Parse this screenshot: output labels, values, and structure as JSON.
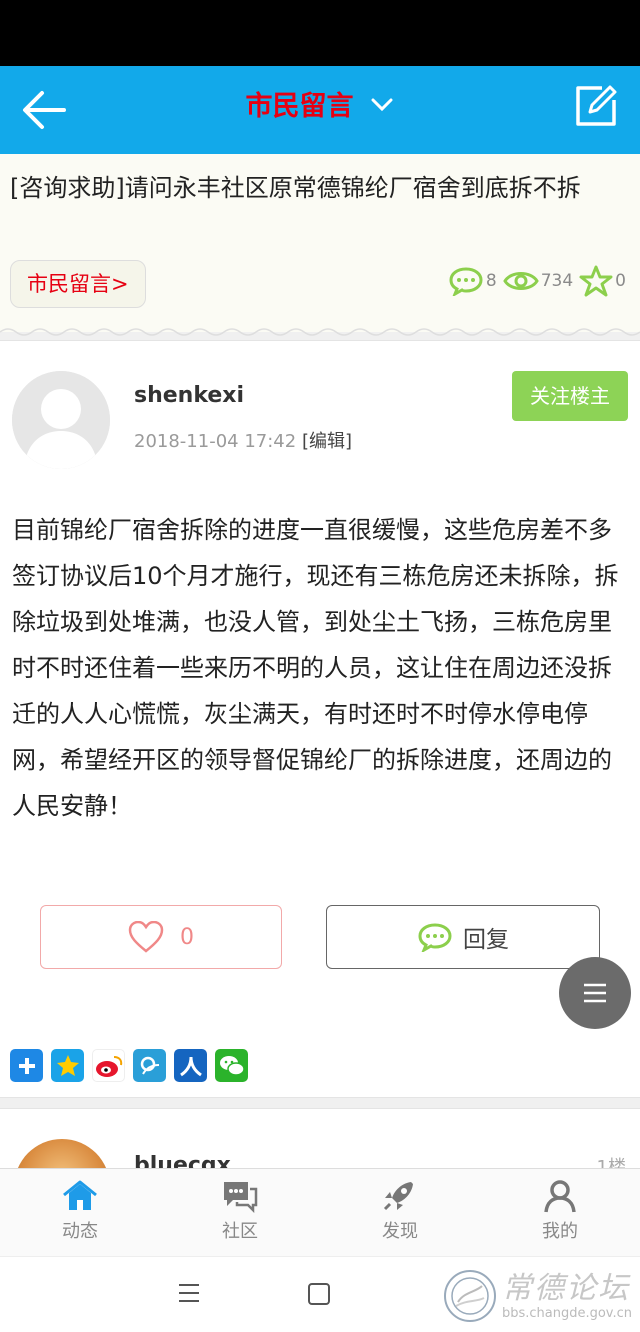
{
  "topbar": {
    "title": "市民留言"
  },
  "post": {
    "title": "[咨询求助]请问永丰社区原常德锦纶厂宿舍到底拆不拆",
    "forum_tag": "市民留言>",
    "stats": {
      "replies": "8",
      "views": "734",
      "favorites": "0"
    },
    "author": "shenkexi",
    "datetime": "2018-11-04 17:42",
    "edit_label": "[编辑]",
    "follow_label": "关注楼主",
    "content": "目前锦纶厂宿舍拆除的进度一直很缓慢，这些危房差不多签订协议后10个月才施行，现还有三栋危房还未拆除，拆除垃圾到处堆满，也没人管，到处尘土飞扬，三栋危房里时不时还住着一些来历不明的人员，这让住在周边还没拆迁的人人心慌慌，灰尘满天，有时还时不时停水停电停网，希望经开区的领导督促锦纶厂的拆除进度，还周边的人民安静！",
    "like_count": "0",
    "reply_label": "回复"
  },
  "reply": {
    "author": "bluecqx",
    "floor": "1楼"
  },
  "tabs": [
    {
      "label": "动态"
    },
    {
      "label": "社区"
    },
    {
      "label": "发现"
    },
    {
      "label": "我的"
    }
  ],
  "watermark": {
    "name": "常德论坛",
    "url": "bbs.changde.gov.cn"
  }
}
